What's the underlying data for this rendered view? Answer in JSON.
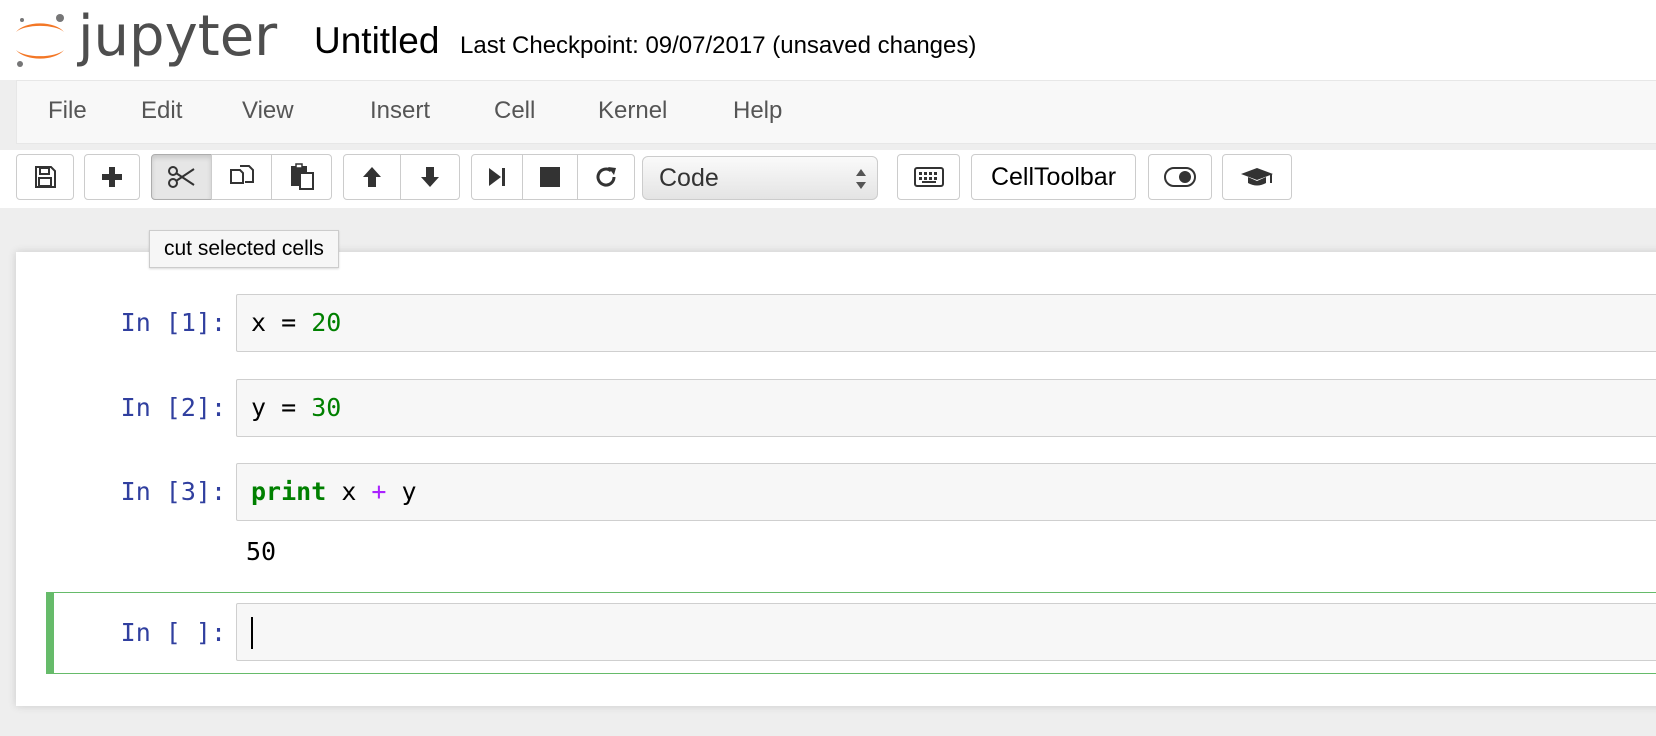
{
  "header": {
    "logo_text": "jupyter",
    "notebook_title": "Untitled",
    "checkpoint": "Last Checkpoint: 09/07/2017 (unsaved changes)"
  },
  "menu": [
    "File",
    "Edit",
    "View",
    "Insert",
    "Cell",
    "Kernel",
    "Help"
  ],
  "toolbar": {
    "cell_type_selected": "Code",
    "celltoolbar_label": "CellToolbar",
    "icons": [
      "save-icon",
      "plus-icon",
      "scissors-icon",
      "copy-icon",
      "paste-icon",
      "arrow-up-icon",
      "arrow-down-icon",
      "step-forward-icon",
      "stop-icon",
      "refresh-icon",
      "keyboard-icon",
      "toggle-icon",
      "graduation-cap-icon"
    ]
  },
  "tooltip": {
    "text": "cut selected cells"
  },
  "cells": [
    {
      "prompt": "In [1]:",
      "code": [
        {
          "t": "x",
          "c": "var"
        },
        {
          "t": " = ",
          "c": "plain"
        },
        {
          "t": "20",
          "c": "num"
        }
      ]
    },
    {
      "prompt": "In [2]:",
      "code": [
        {
          "t": "y",
          "c": "var"
        },
        {
          "t": " = ",
          "c": "plain"
        },
        {
          "t": "30",
          "c": "num"
        }
      ]
    },
    {
      "prompt": "In [3]:",
      "code": [
        {
          "t": "print",
          "c": "kw"
        },
        {
          "t": " x ",
          "c": "plain"
        },
        {
          "t": "+",
          "c": "op"
        },
        {
          "t": " y",
          "c": "plain"
        }
      ],
      "output": "50"
    },
    {
      "prompt": "In [ ]:",
      "code": [],
      "active": true
    }
  ]
}
